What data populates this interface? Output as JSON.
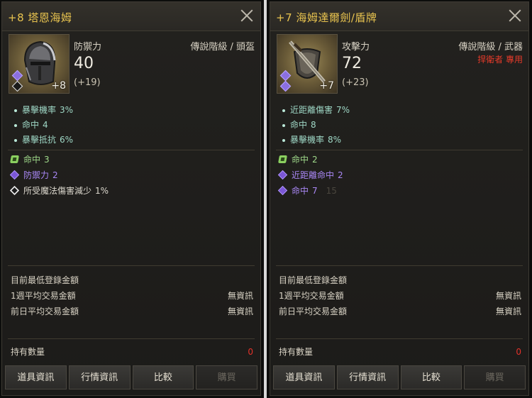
{
  "left": {
    "title": "+8 塔恩海姆",
    "enhance": "+8",
    "stat_label": "防禦力",
    "stat_value": "40",
    "stat_bonus": "(+19)",
    "grade": "傳說階級 / 頭盔",
    "exclusive": "",
    "base_stats": [
      {
        "name": "暴擊機率",
        "value": "3%"
      },
      {
        "name": "命中",
        "value": "4"
      },
      {
        "name": "暴擊抵抗",
        "value": "6%"
      }
    ],
    "options": [
      {
        "kind": "green",
        "name": "命中",
        "value": "3",
        "ghost": ""
      },
      {
        "kind": "purple",
        "name": "防禦力",
        "value": "2",
        "ghost": ""
      },
      {
        "kind": "white",
        "name": "所受魔法傷害減少",
        "value": "1%",
        "ghost": ""
      }
    ],
    "market": {
      "min_price_label": "目前最低登錄金額",
      "week_avg_label": "1週平均交易金額",
      "week_avg_value": "無資訊",
      "prev_day_label": "前日平均交易金額",
      "prev_day_value": "無資訊"
    },
    "holding_label": "持有數量",
    "holding_value": "0",
    "buttons": [
      "道具資訊",
      "行情資訊",
      "比較",
      "購買"
    ]
  },
  "right": {
    "title": "+7 海姆達爾劍/盾牌",
    "enhance": "+7",
    "stat_label": "攻擊力",
    "stat_value": "72",
    "stat_bonus": "(+23)",
    "grade": "傳說階級 / 武器",
    "exclusive": "捍衛者 專用",
    "base_stats": [
      {
        "name": "近距離傷害",
        "value": "7%"
      },
      {
        "name": "命中",
        "value": "8"
      },
      {
        "name": "暴擊機率",
        "value": "8%"
      }
    ],
    "options": [
      {
        "kind": "green",
        "name": "命中",
        "value": "2",
        "ghost": ""
      },
      {
        "kind": "purple",
        "name": "近距離命中",
        "value": "2",
        "ghost": ""
      },
      {
        "kind": "purple",
        "name": "命中",
        "value": "7",
        "ghost": "15"
      }
    ],
    "market": {
      "min_price_label": "目前最低登錄金額",
      "week_avg_label": "1週平均交易金額",
      "week_avg_value": "無資訊",
      "prev_day_label": "前日平均交易金額",
      "prev_day_value": "無資訊"
    },
    "holding_label": "持有數量",
    "holding_value": "0",
    "buttons": [
      "道具資訊",
      "行情資訊",
      "比較",
      "購買"
    ]
  },
  "icons": {
    "left_item": "helmet-icon",
    "right_item": "sword-shield-icon",
    "close": "close-icon"
  },
  "colors": {
    "title": "#e8c34f",
    "base_stat": "#9fd8c6",
    "green_option": "#9fd98a",
    "purple_option": "#a987f5",
    "exclusive": "#e53a2a",
    "holding_zero": "#e5322a"
  }
}
